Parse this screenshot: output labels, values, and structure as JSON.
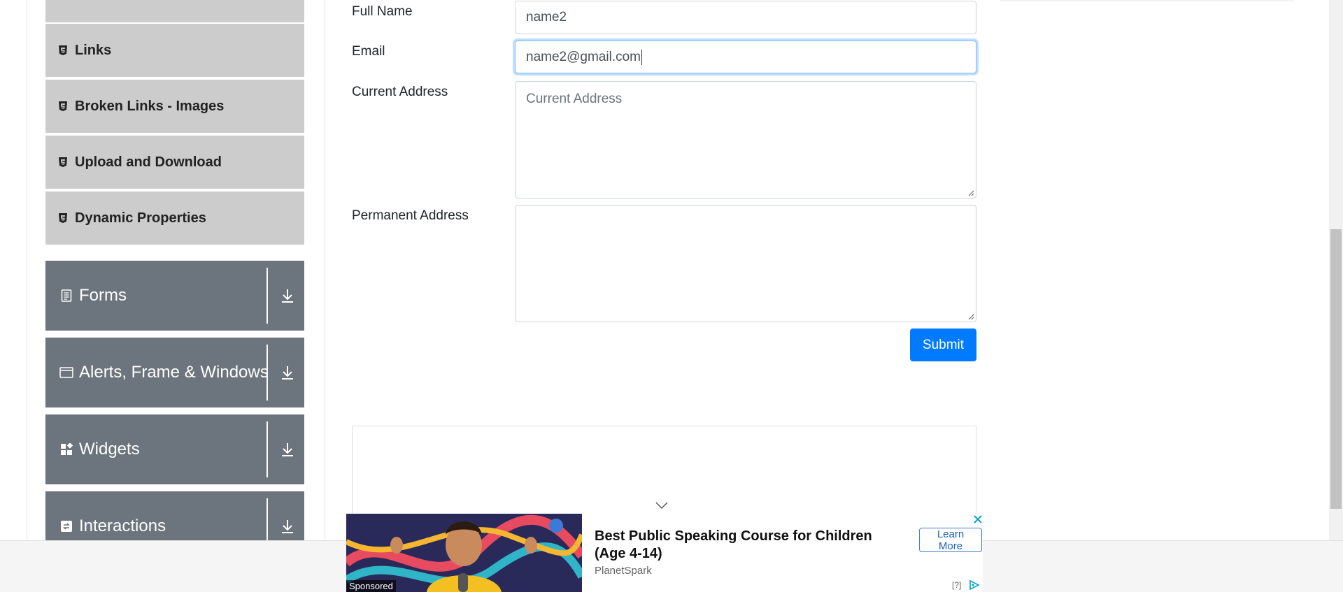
{
  "sidebar": {
    "sub_items": [
      {
        "label": "Links"
      },
      {
        "label": "Broken Links - Images"
      },
      {
        "label": "Upload and Download"
      },
      {
        "label": "Dynamic Properties"
      }
    ],
    "groups": [
      {
        "label": "Forms",
        "icon": "document-icon"
      },
      {
        "label": "Alerts, Frame & Windows",
        "icon": "window-icon"
      },
      {
        "label": "Widgets",
        "icon": "widgets-icon"
      },
      {
        "label": "Interactions",
        "icon": "interactions-icon"
      }
    ]
  },
  "form": {
    "full_name": {
      "label": "Full Name",
      "value": "name2"
    },
    "email": {
      "label": "Email",
      "value": "name2@gmail.com"
    },
    "current_address": {
      "label": "Current Address",
      "placeholder": "Current Address",
      "value": ""
    },
    "permanent_address": {
      "label": "Permanent Address",
      "value": ""
    },
    "submit_label": "Submit"
  },
  "ad": {
    "title": "Best Public Speaking Course for Children (Age 4-14)",
    "brand": "PlanetSpark",
    "cta": "Learn More",
    "sponsored": "Sponsored",
    "help": "[?]"
  },
  "colors": {
    "primary": "#007bff",
    "sidebar_group": "#6c757d",
    "sidebar_item": "#cccccc"
  }
}
